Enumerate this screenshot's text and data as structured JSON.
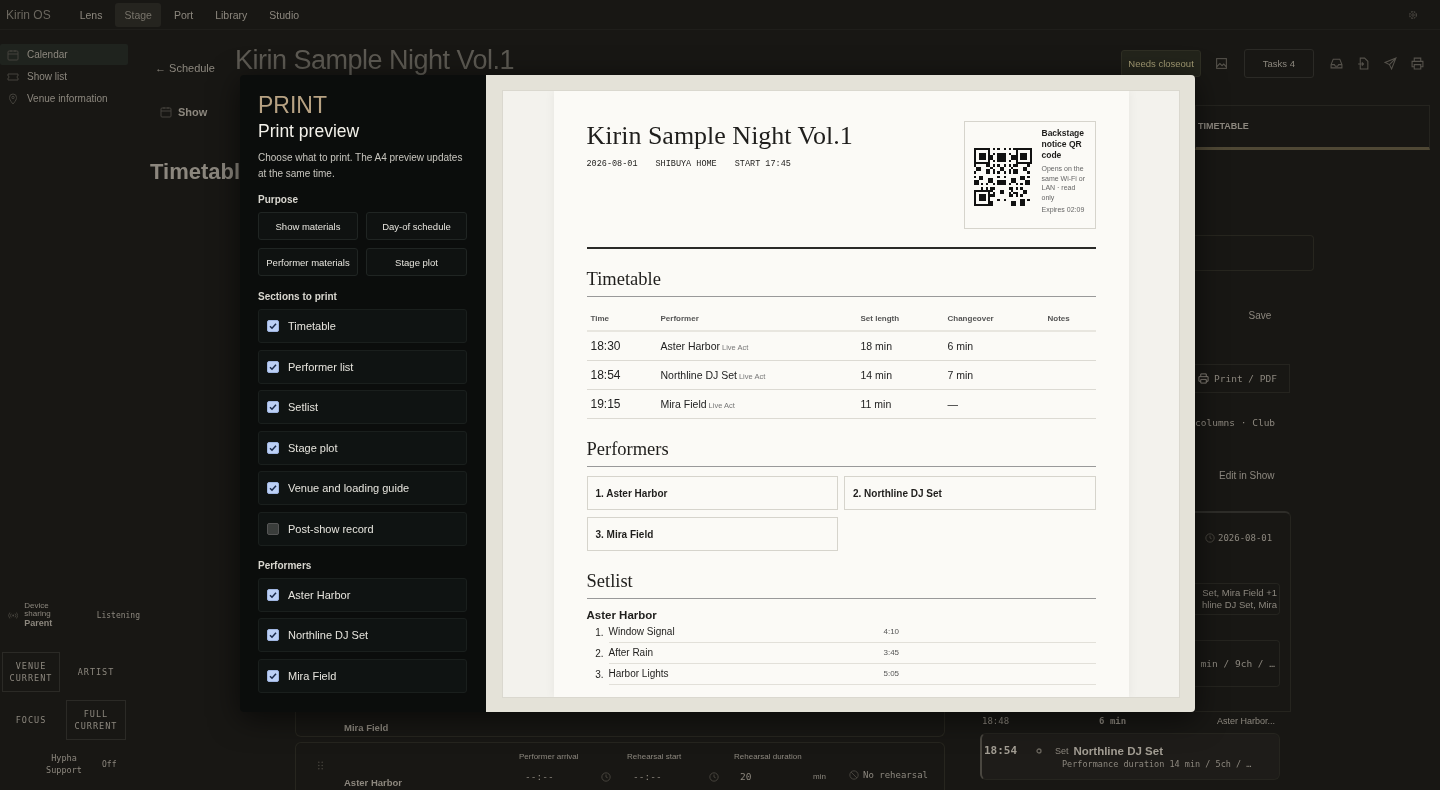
{
  "top_bar": {
    "brand": "Kirin OS",
    "tabs": [
      {
        "label": "Lens",
        "selected": false
      },
      {
        "label": "Stage",
        "selected": true
      },
      {
        "label": "Port",
        "selected": false
      },
      {
        "label": "Library",
        "selected": false
      },
      {
        "label": "Studio",
        "selected": false
      }
    ]
  },
  "sidebar": {
    "items": [
      {
        "label": "Calendar",
        "selected": true
      },
      {
        "label": "Show list",
        "selected": false
      },
      {
        "label": "Venue information",
        "selected": false
      }
    ],
    "device_sharing": {
      "label": "Device sharing",
      "role": "Parent",
      "status": "Listening"
    },
    "modes": [
      {
        "label": "VENUE",
        "note": "CURRENT",
        "selected": true
      },
      {
        "label": "ARTIST",
        "selected": false
      },
      {
        "label": "FOCUS",
        "selected": false
      },
      {
        "label": "FULL",
        "note": "CURRENT",
        "selected": true
      }
    ],
    "support": {
      "label": "Hypha Support",
      "status": "Off"
    }
  },
  "header": {
    "back": "← Schedule",
    "title": "Kirin Sample Night Vol.1",
    "closeout": "Needs closeout",
    "tasks": "Tasks 4"
  },
  "show_tab": "Show",
  "section_heading": "Timetabl",
  "right_panel": {
    "tab": "TIMETABLE",
    "save": "Save",
    "print": "Print / PDF",
    "layout_note": "columns · Club",
    "edit": "Edit in Show",
    "date": "2026-08-01",
    "lineup": "Set, Mira Field +1\nhline DJ Set, Mira",
    "spec": "min / 9ch / …"
  },
  "rundown": {
    "first_name": "Mira Field",
    "second": {
      "name": "Aster Harbor",
      "fields": [
        {
          "label": "Performer arrival",
          "value": "--:--"
        },
        {
          "label": "Rehearsal start",
          "value": "--:--"
        },
        {
          "label": "Rehearsal duration",
          "value": "20",
          "unit": "min"
        }
      ],
      "rehearsal": "No rehearsal"
    }
  },
  "schedule_strip": {
    "changeover": {
      "time": "18:48",
      "length": "6 min",
      "next": "Aster Harbor..."
    },
    "item": {
      "time": "18:54",
      "kind": "Set",
      "name": "Northline DJ Set",
      "detail": "Performance duration 14 min / 5ch / …"
    }
  },
  "print_dialog": {
    "eyebrow": "PRINT",
    "title": "Print preview",
    "description": "Choose what to print. The A4 preview updates at the same time.",
    "purpose_heading": "Purpose",
    "purposes": [
      "Show materials",
      "Day-of schedule",
      "Performer materials",
      "Stage plot"
    ],
    "sections_heading": "Sections to print",
    "sections": [
      {
        "label": "Timetable",
        "checked": true
      },
      {
        "label": "Performer list",
        "checked": true
      },
      {
        "label": "Setlist",
        "checked": true
      },
      {
        "label": "Stage plot",
        "checked": true
      },
      {
        "label": "Venue and loading guide",
        "checked": true
      },
      {
        "label": "Post-show record",
        "checked": false
      }
    ],
    "performers_heading": "Performers",
    "performers": [
      {
        "label": "Aster Harbor",
        "checked": true
      },
      {
        "label": "Northline DJ Set",
        "checked": true
      },
      {
        "label": "Mira Field",
        "checked": true
      }
    ]
  },
  "preview": {
    "title": "Kirin Sample Night Vol.1",
    "meta": [
      "2026-08-01",
      "SHIBUYA HOME",
      "START 17:45"
    ],
    "qr": {
      "title": "Backstage notice QR code",
      "note": "Opens on the same Wi-Fi or LAN · read only",
      "expires": "Expires 02:09"
    },
    "timetable": {
      "heading": "Timetable",
      "columns": [
        "Time",
        "Performer",
        "Set length",
        "Changeover",
        "Notes"
      ],
      "rows": [
        {
          "time": "18:30",
          "performer": "Aster Harbor",
          "act": "Live Act",
          "set_length": "18 min",
          "changeover": "6 min"
        },
        {
          "time": "18:54",
          "performer": "Northline DJ Set",
          "act": "Live Act",
          "set_length": "14 min",
          "changeover": "7 min"
        },
        {
          "time": "19:15",
          "performer": "Mira Field",
          "act": "Live Act",
          "set_length": "11 min",
          "changeover": "—"
        }
      ]
    },
    "performers": {
      "heading": "Performers",
      "items": [
        "1. Aster Harbor",
        "2. Northline DJ Set",
        "3. Mira Field"
      ]
    },
    "setlist": {
      "heading": "Setlist",
      "groups": [
        {
          "performer": "Aster Harbor",
          "songs": [
            {
              "no": "1.",
              "title": "Window Signal",
              "duration": "4:10"
            },
            {
              "no": "2.",
              "title": "After Rain",
              "duration": "3:45"
            },
            {
              "no": "3.",
              "title": "Harbor Lights",
              "duration": "5:05"
            }
          ]
        }
      ]
    }
  }
}
